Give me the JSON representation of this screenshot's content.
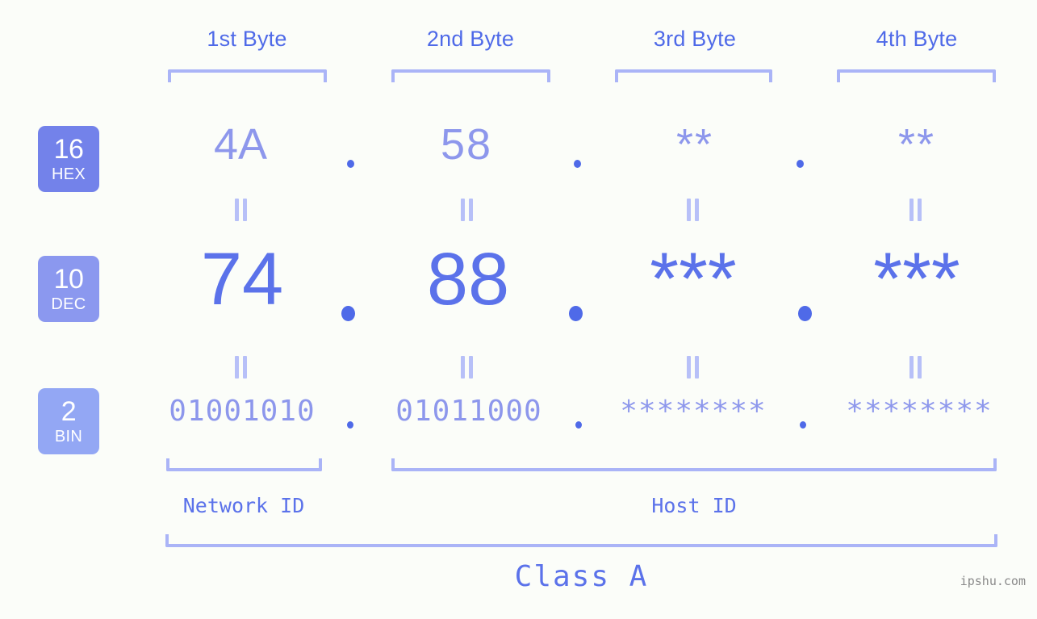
{
  "background_color": "#fbfdf9",
  "accent_colors": {
    "strong_blue": "#4f6ae8",
    "dec_blue": "#5b72ea",
    "light_blue": "#8d97ec",
    "bracket_blue": "#aab4f7",
    "badge_hex": "#7382ea",
    "badge_dec": "#8b98ef",
    "badge_bin": "#93a7f4",
    "watermark_gray": "#8a8a8a"
  },
  "headers": {
    "byte_labels": [
      "1st Byte",
      "2nd Byte",
      "3rd Byte",
      "4th Byte"
    ]
  },
  "bases": [
    {
      "number": "16",
      "name": "HEX"
    },
    {
      "number": "10",
      "name": "DEC"
    },
    {
      "number": "2",
      "name": "BIN"
    }
  ],
  "rows": {
    "hex": {
      "base_number": "16",
      "base_name": "HEX",
      "values": [
        "4A",
        "58",
        "**",
        "**"
      ],
      "separators": [
        ".",
        ".",
        "."
      ]
    },
    "dec": {
      "base_number": "10",
      "base_name": "DEC",
      "values": [
        "74",
        "88",
        "***",
        "***"
      ],
      "separators": [
        ".",
        ".",
        "."
      ]
    },
    "bin": {
      "base_number": "2",
      "base_name": "BIN",
      "values": [
        "01001010",
        "01011000",
        "********",
        "********"
      ],
      "separators": [
        ".",
        ".",
        "."
      ]
    }
  },
  "equals_connector": "=",
  "segments": {
    "network_id_label": "Network ID",
    "host_id_label": "Host ID"
  },
  "class_label": "Class A",
  "watermark": "ipshu.com"
}
